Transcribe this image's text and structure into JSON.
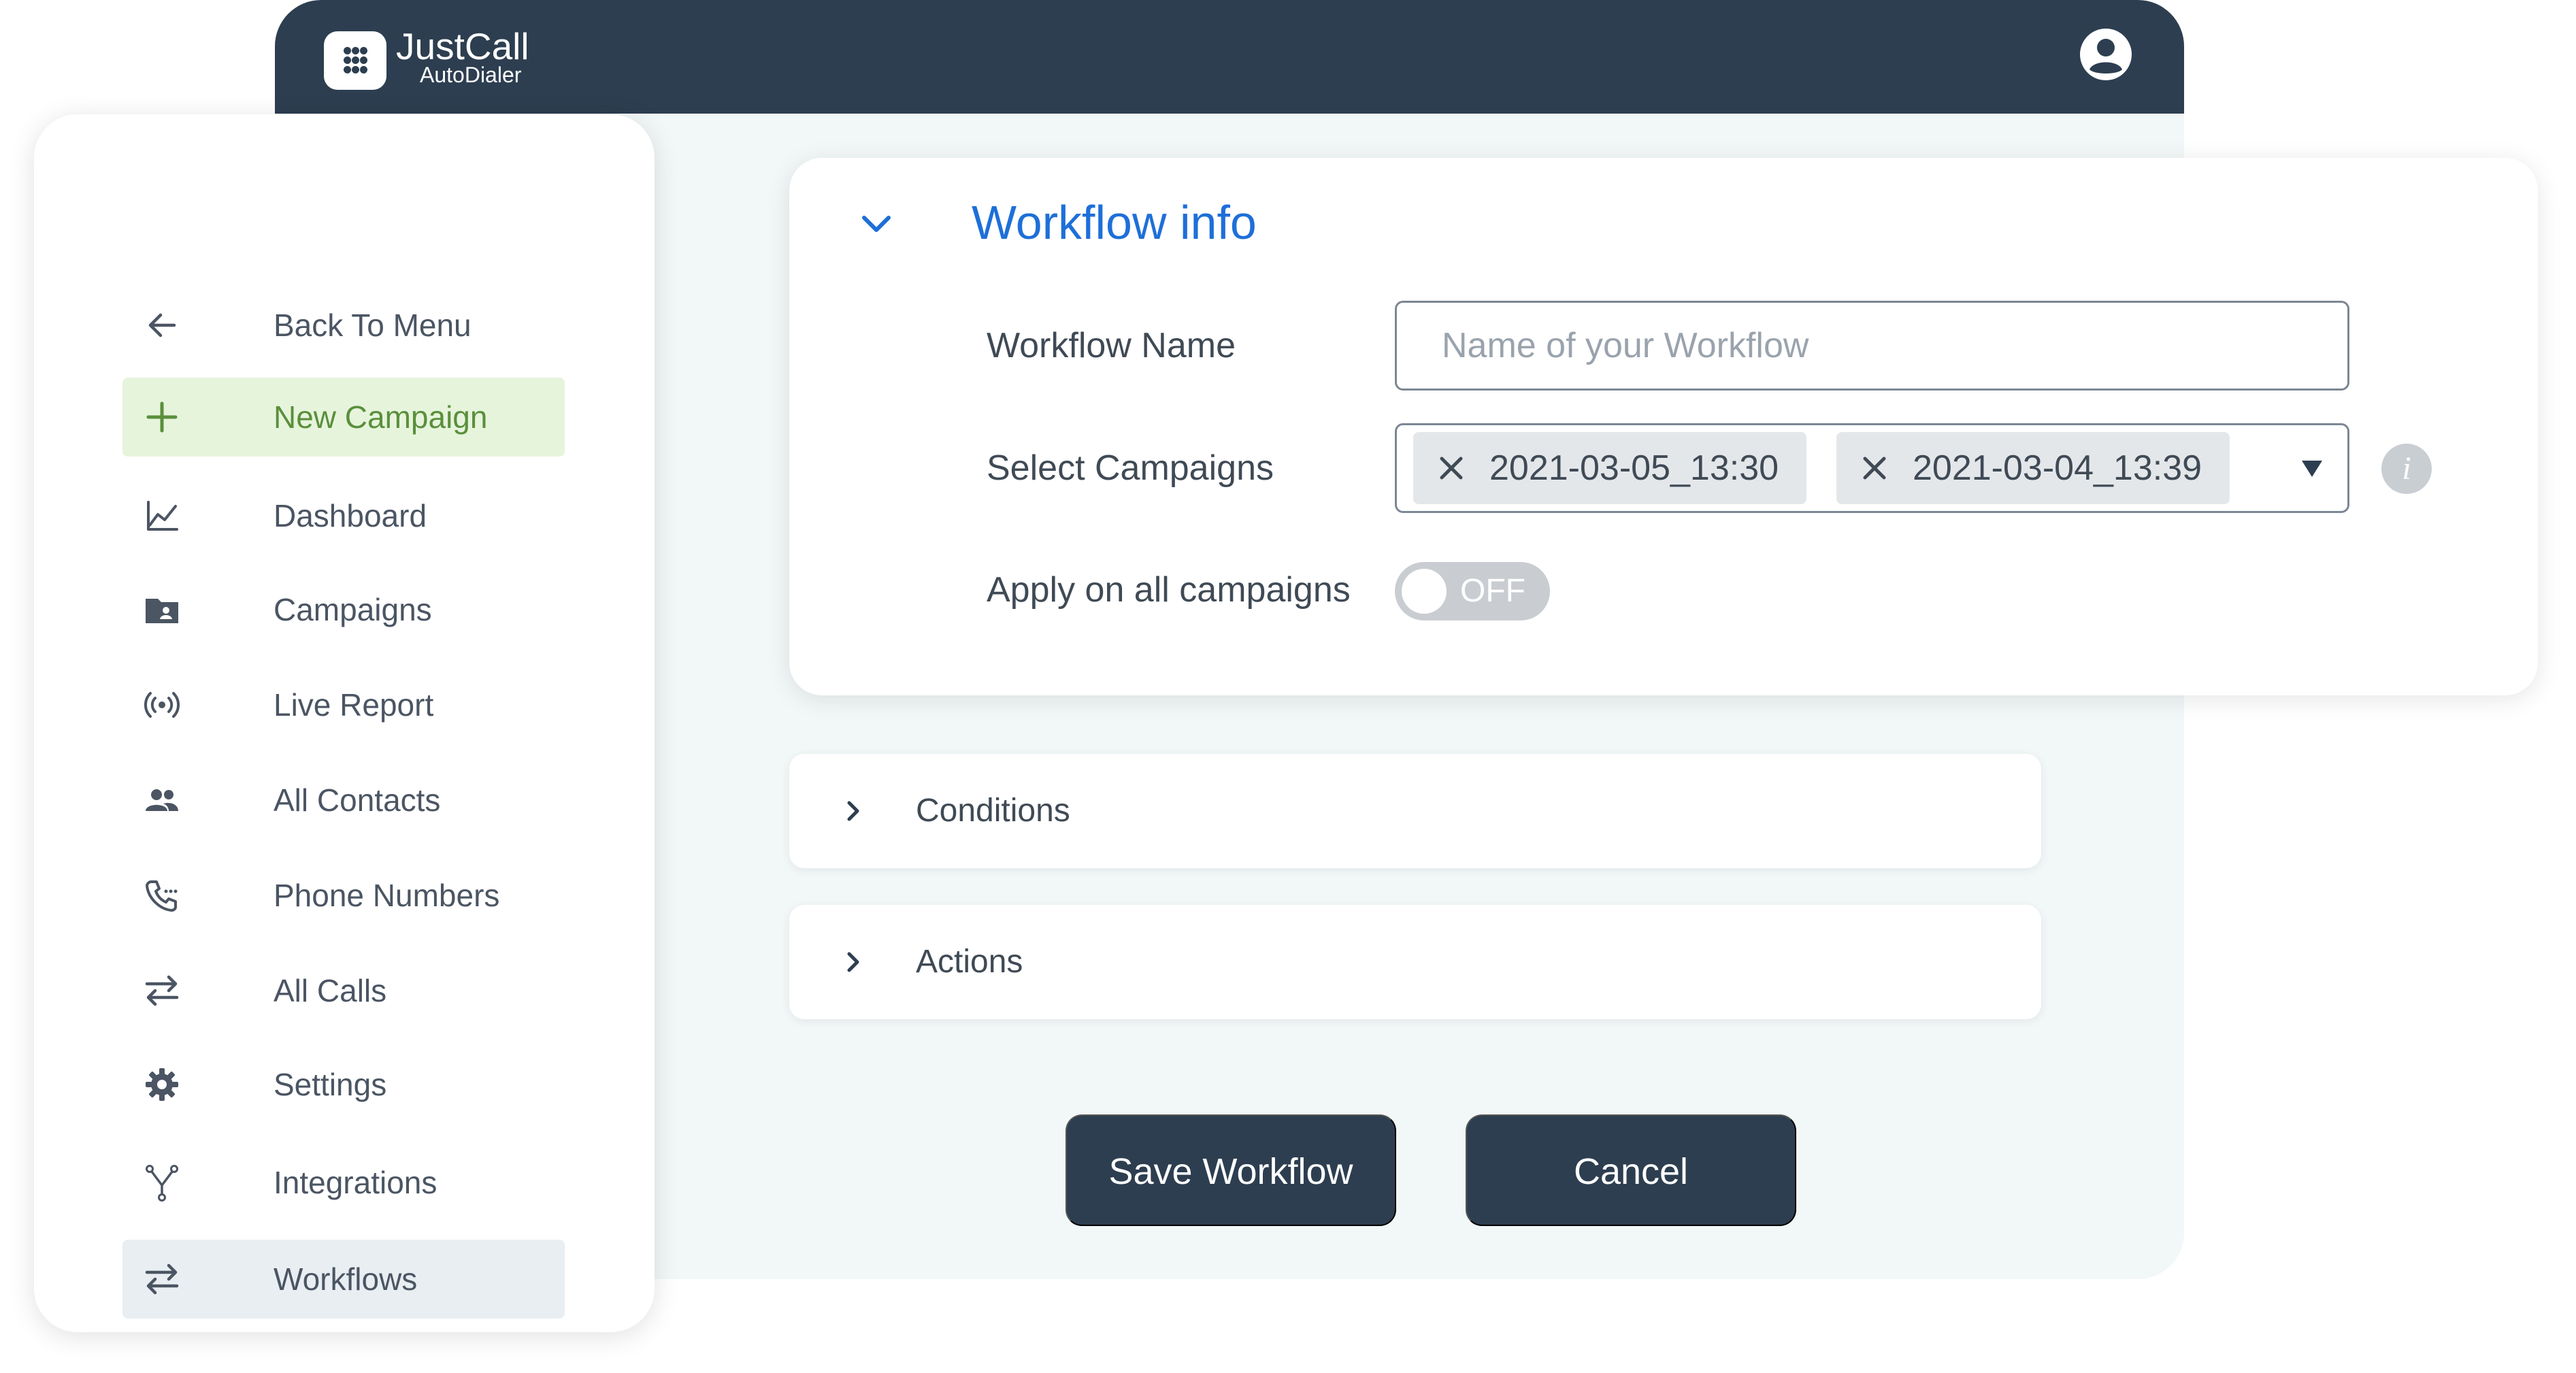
{
  "header": {
    "brand_name": "JustCall",
    "brand_sub": "AutoDialer"
  },
  "sidebar": {
    "items": [
      {
        "label": "Back To Menu",
        "icon": "arrow-left-icon"
      },
      {
        "label": "New Campaign",
        "icon": "plus-icon",
        "state": "highlighted"
      },
      {
        "label": "Dashboard",
        "icon": "line-chart-icon"
      },
      {
        "label": "Campaigns",
        "icon": "folder-contact-icon"
      },
      {
        "label": "Live Report",
        "icon": "broadcast-icon"
      },
      {
        "label": "All Contacts",
        "icon": "people-icon"
      },
      {
        "label": "Phone Numbers",
        "icon": "phone-icon"
      },
      {
        "label": "All Calls",
        "icon": "swap-arrows-icon"
      },
      {
        "label": "Settings",
        "icon": "gear-icon"
      },
      {
        "label": "Integrations",
        "icon": "fork-icon"
      },
      {
        "label": "Workflows",
        "icon": "swap-arrows-icon",
        "state": "selected"
      }
    ]
  },
  "workflow_info": {
    "title": "Workflow info",
    "name_label": "Workflow Name",
    "name_placeholder": "Name of your Workflow",
    "name_value": "",
    "campaigns_label": "Select Campaigns",
    "selected_campaigns": [
      "2021-03-05_13:30",
      "2021-03-04_13:39"
    ],
    "apply_all_label": "Apply on all campaigns",
    "apply_all_toggle": "OFF"
  },
  "sections": {
    "conditions": "Conditions",
    "actions": "Actions"
  },
  "buttons": {
    "save": "Save Workflow",
    "cancel": "Cancel"
  },
  "colors": {
    "header_bg": "#2d3e50",
    "accent_blue": "#1e6fd9",
    "highlight_green_bg": "#e6f4dc",
    "highlight_green_text": "#5a8f3b",
    "selected_grey_bg": "#e9eef2",
    "button_bg": "#2d3e50",
    "content_bg": "#f2f7f8"
  }
}
